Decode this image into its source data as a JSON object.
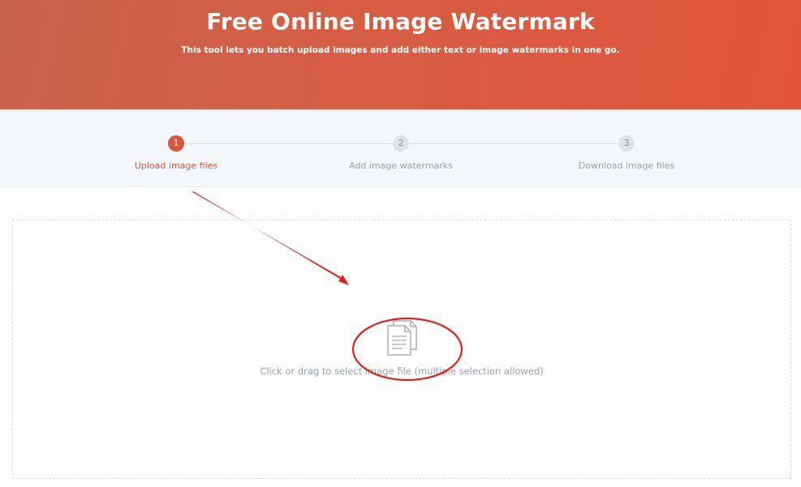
{
  "hero": {
    "title": "Free Online Image Watermark",
    "subtitle": "This tool lets you batch upload images and add either text or image watermarks in one go."
  },
  "steps": [
    {
      "number": "1",
      "label": "Upload image files",
      "active": true
    },
    {
      "number": "2",
      "label": "Add image watermarks",
      "active": false
    },
    {
      "number": "3",
      "label": "Download image files",
      "active": false
    }
  ],
  "upload": {
    "icon": "documents-icon",
    "instruction": "Click or drag to select image file (multiple selection allowed)"
  },
  "colors": {
    "accent": "#d9553d",
    "hero_start": "#c9624a",
    "hero_end": "#e2553b",
    "annotation": "#e0201c"
  }
}
